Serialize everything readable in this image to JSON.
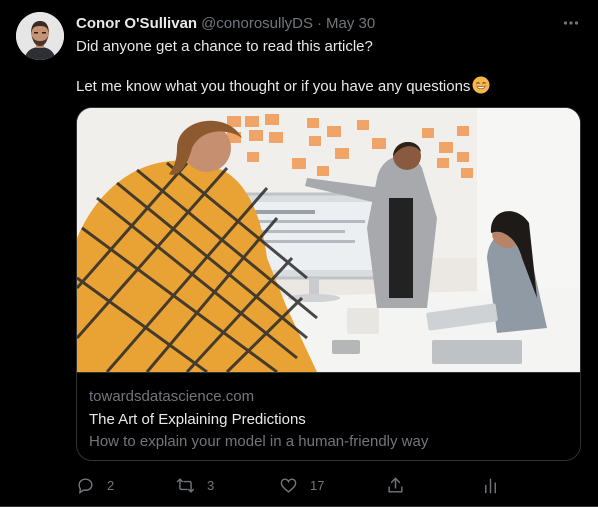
{
  "tweet": {
    "author_name": "Conor O'Sullivan",
    "author_handle": "@conorosullyDS",
    "separator": "·",
    "date": "May 30",
    "text_line1": "Did anyone get a chance to read this article?",
    "text_line2": "Let me know what you thought or if you have any questions"
  },
  "card": {
    "domain": "towardsdatascience.com",
    "title": "The Art of Explaining Predictions",
    "description": "How to explain your model in a human-friendly way"
  },
  "actions": {
    "replies": "2",
    "retweets": "3",
    "likes": "17"
  },
  "colors": {
    "background": "#000000",
    "text_primary": "#e7e9ea",
    "text_secondary": "#71767b",
    "border": "#2f3336"
  },
  "icons": [
    "more-icon",
    "smile-emoji-icon",
    "reply-icon",
    "retweet-icon",
    "like-icon",
    "share-icon",
    "analytics-icon"
  ]
}
